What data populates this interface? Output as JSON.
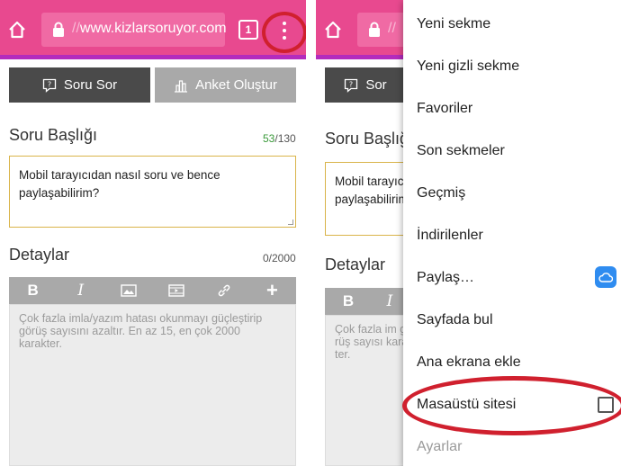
{
  "browser": {
    "url_scheme": "//",
    "url_host": "www.kizlarsoruyor.com",
    "url_host_truncated": "",
    "tab_count": "1"
  },
  "page": {
    "ask_button": "Soru Sor",
    "ask_button_short": "Sor",
    "poll_button": "Anket Oluştur",
    "title_label": "Soru Başlığı",
    "title_label_short": "Soru Başlığ",
    "title_counter_used": "53",
    "title_counter_total": "/130",
    "title_value": "Mobil tarayıcıdan nasıl soru ve bence paylaşabilirim?",
    "title_value_line1_short": "Mobil tarayıc",
    "title_value_line2_short": "paylaşabilirim",
    "details_label": "Detaylar",
    "details_counter": "0/2000",
    "details_placeholder": "Çok fazla imla/yazım hatası okunmayı güçleştirip görüş sayısını azaltır. En az 15, en çok 2000 karakter.",
    "details_placeholder_short": "Çok fazla im görüş sayısı karakter.",
    "editor_bold": "B",
    "editor_italic": "I",
    "editor_add": "+"
  },
  "menu": {
    "items": [
      "Yeni sekme",
      "Yeni gizli sekme",
      "Favoriler",
      "Son sekmeler",
      "Geçmiş",
      "İndirilenler",
      "Paylaş…",
      "Sayfada bul",
      "Ana ekrana ekle",
      "Masaüstü sitesi",
      "Ayarlar"
    ],
    "desktop_site_checked": false
  },
  "colors": {
    "toolbar": "#e8498f",
    "toolbar_underline": "#b42bbd",
    "highlight_ring": "#d0202e",
    "dark_button": "#4a4a4a",
    "light_button": "#a9a9a9",
    "counter_green": "#3a9a3a"
  }
}
